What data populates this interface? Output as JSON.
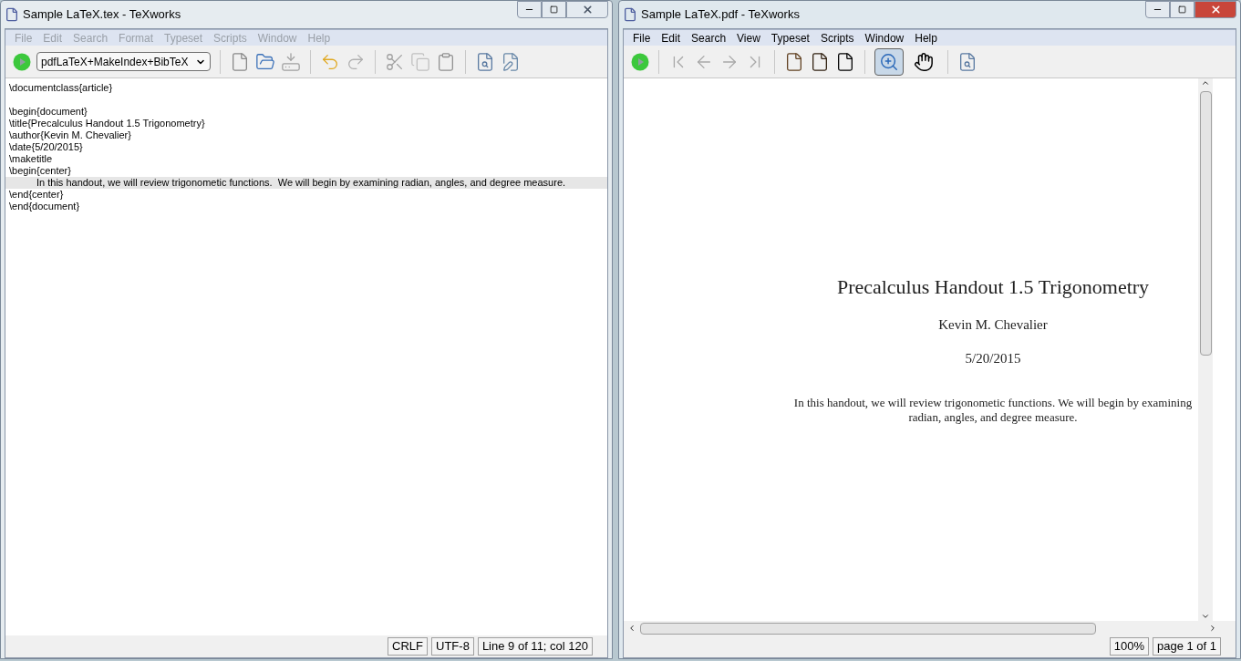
{
  "editor_window": {
    "title": "Sample LaTeX.tex - TeXworks",
    "active": false,
    "menu": [
      "File",
      "Edit",
      "Search",
      "Format",
      "Typeset",
      "Scripts",
      "Window",
      "Help"
    ],
    "engine": "pdfLaTeX+MakeIndex+BibTeX",
    "lines": [
      {
        "kind": "code",
        "text": "\\documentclass{article}",
        "highlighted": false
      },
      {
        "kind": "blank",
        "highlighted": false
      },
      {
        "kind": "code",
        "text": "\\begin{document}",
        "highlighted": false
      },
      {
        "kind": "code",
        "text": "\\title{Precalculus Handout 1.5 Trigonometry}",
        "highlighted": false
      },
      {
        "kind": "code",
        "text": "\\author{Kevin M. Chevalier}",
        "highlighted": false
      },
      {
        "kind": "code",
        "text": "\\date{5/20/2015}",
        "highlighted": false
      },
      {
        "kind": "code",
        "text": "\\maketitle",
        "highlighted": false
      },
      {
        "kind": "code",
        "text": "\\begin{center}",
        "highlighted": false
      },
      {
        "kind": "indented",
        "text": "In this handout, we will review trigonometic functions.  We will begin by examining radian, angles, and degree measure.",
        "highlighted": true
      },
      {
        "kind": "code",
        "text": "\\end{center}",
        "highlighted": false
      },
      {
        "kind": "code",
        "text": "\\end{document}",
        "highlighted": false
      }
    ],
    "status": [
      "CRLF",
      "UTF-8",
      "Line 9 of 11; col 120"
    ]
  },
  "pdf_window": {
    "title": "Sample LaTeX.pdf - TeXworks",
    "active": true,
    "menu": [
      "File",
      "Edit",
      "Search",
      "View",
      "Typeset",
      "Scripts",
      "Window",
      "Help"
    ],
    "tools": [
      {
        "kind": "zoom",
        "selected": true
      },
      {
        "kind": "hand",
        "selected": false
      }
    ],
    "page": {
      "title": "Precalculus Handout 1.5 Trigonometry",
      "author": "Kevin M. Chevalier",
      "date": "5/20/2015",
      "abstract": "In this handout, we will review trigonometic functions. We will begin by examining radian, angles, and degree measure."
    },
    "status": [
      "100%",
      "page 1 of 1"
    ]
  }
}
